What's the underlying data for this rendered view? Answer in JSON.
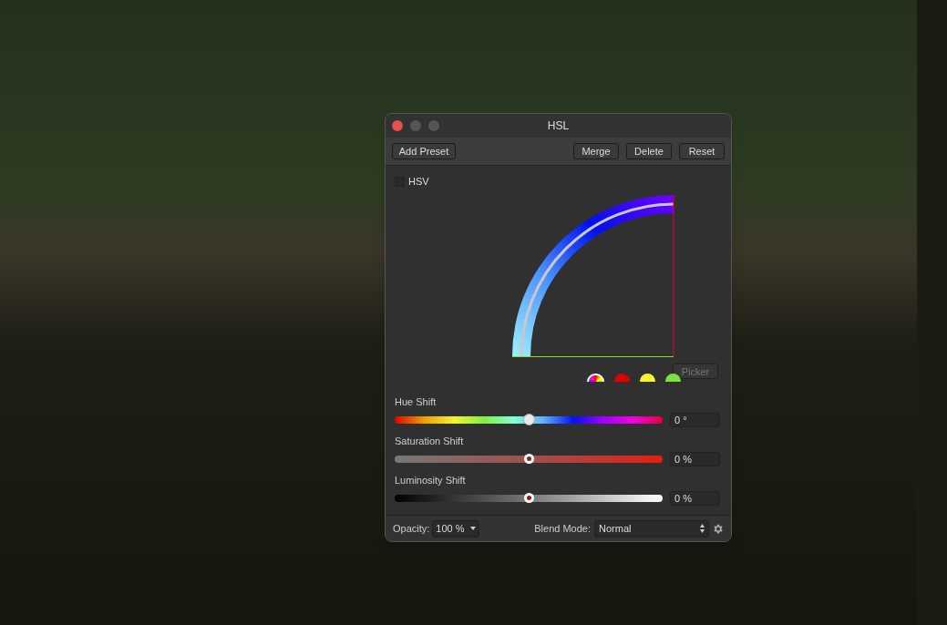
{
  "window": {
    "title": "HSL"
  },
  "toolbar": {
    "left": [
      {
        "label": "Add Preset"
      }
    ],
    "right": [
      {
        "label": "Merge"
      },
      {
        "label": "Delete"
      },
      {
        "label": "Reset"
      }
    ]
  },
  "hsv": {
    "label": "HSV",
    "checked": false
  },
  "picker": {
    "label": "Picker",
    "disabled": true
  },
  "swatches": [
    {
      "kind": "wheel",
      "selected": true
    },
    {
      "kind": "color",
      "color": "#e00000",
      "selected": false
    },
    {
      "kind": "color",
      "color": "#f5f52a",
      "selected": false
    },
    {
      "kind": "color",
      "color": "#80e040",
      "selected": false
    }
  ],
  "sliders": [
    {
      "kind": "hue",
      "label": "Hue Shift",
      "level": 0.5,
      "reading": "0 °"
    },
    {
      "kind": "saturation",
      "label": "Saturation Shift",
      "level": 0.5,
      "reading": "0 %"
    },
    {
      "kind": "luminosity",
      "label": "Luminosity Shift",
      "level": 0.5,
      "reading": "0 %"
    }
  ],
  "footer": {
    "opacity_label": "Opacity:",
    "opacity": "100 %",
    "blend_label": "Blend Mode:",
    "blend": "Normal"
  }
}
